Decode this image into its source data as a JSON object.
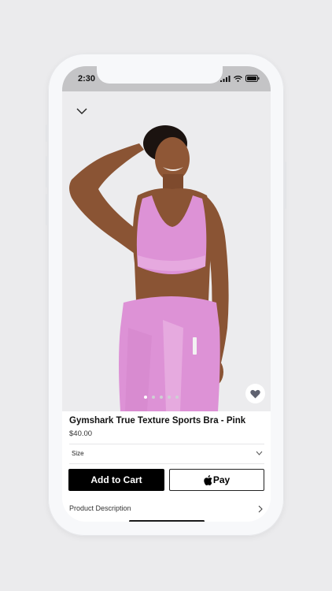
{
  "status_bar": {
    "time": "2:30"
  },
  "gallery": {
    "images": 5,
    "active_index": 0
  },
  "product": {
    "title": "Gymshark True Texture Sports Bra - Pink",
    "price": "$40.00"
  },
  "size_selector": {
    "label": "Size"
  },
  "actions": {
    "add_to_cart": "Add to Cart",
    "apple_pay": "Pay"
  },
  "product_description": {
    "label": "Product Description"
  },
  "colors": {
    "background": "#ebebed",
    "phone_frame": "#f7f8fa",
    "apparel_pink": "#dd92d6",
    "skin": "#8a5434",
    "button_black": "#000000"
  },
  "icons": [
    "chevron-down-icon",
    "signal-icon",
    "wifi-icon",
    "battery-icon",
    "heart-icon",
    "apple-logo-icon",
    "chevron-right-icon"
  ]
}
